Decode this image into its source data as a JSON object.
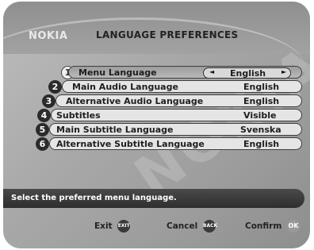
{
  "header": {
    "logo": "NOKIA",
    "title": "LANGUAGE PREFERENCES"
  },
  "menu": {
    "items": [
      {
        "number": "1",
        "label": "Menu Language",
        "value": "English"
      },
      {
        "number": "2",
        "label": "Main Audio Language",
        "value": "English"
      },
      {
        "number": "3",
        "label": "Alternative Audio Language",
        "value": "English"
      },
      {
        "number": "4",
        "label": "Subtitles",
        "value": "Visible"
      },
      {
        "number": "5",
        "label": "Main Subtitle Language",
        "value": "Svenska"
      },
      {
        "number": "6",
        "label": "Alternative Subtitle Language",
        "value": "English"
      }
    ],
    "selected_index": 0,
    "arrow_left": "◄",
    "arrow_right": "►"
  },
  "help": {
    "text": "Select the preferred menu language."
  },
  "footer": {
    "exit_label": "Exit",
    "exit_key": "EXIT",
    "cancel_label": "Cancel",
    "cancel_key": "BACK",
    "confirm_label": "Confirm",
    "confirm_key": "OK"
  },
  "colors": {
    "background": "#a8a8a8",
    "pill": "#e5e5e5",
    "help_bar": "#3a3a3a"
  }
}
